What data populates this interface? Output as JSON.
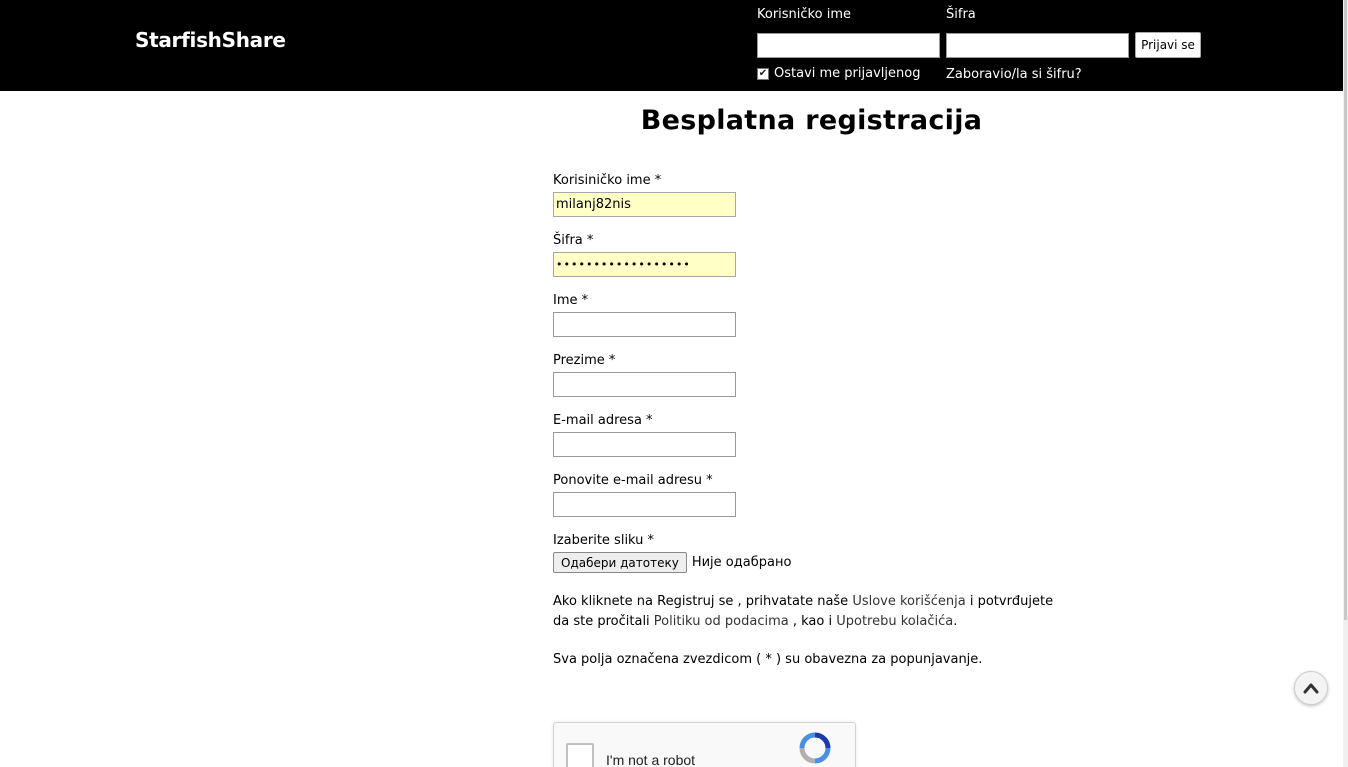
{
  "header": {
    "brand": "StarfishShare",
    "username_label": "Korisničko ime",
    "password_label": "Šifra",
    "login_button": "Prijavi se",
    "remember_label": "Ostavi me prijavljenog",
    "forgot_link": "Zaboravio/la si šifru?",
    "remember_checked": true
  },
  "page": {
    "title": "Besplatna registracija"
  },
  "form": {
    "fields": [
      {
        "label": "Korisiničko ime *",
        "value": "milanj82nis",
        "type": "text"
      },
      {
        "label": "Šifra *",
        "value": "••••••••••••••••••",
        "type": "password"
      },
      {
        "label": "Ime *",
        "value": "",
        "type": "text"
      },
      {
        "label": "Prezime *",
        "value": "",
        "type": "text"
      },
      {
        "label": "E-mail adresa *",
        "value": "",
        "type": "text"
      },
      {
        "label": "Ponovite e-mail adresu *",
        "value": "",
        "type": "text"
      }
    ],
    "image_label": "Izaberite sliku *",
    "file_button": "Одабери датотеку",
    "file_status": "Није одабрано"
  },
  "terms": {
    "part1": "Ako kliknete na Registruj se , prihvatate naše ",
    "link1": "Uslove korišćenja",
    "part2": " i potvrđujete da ste pročitali ",
    "link2": "Politiku od podacima",
    "part3": " , kao i ",
    "link3": "Upotrebu kolačića",
    "part4": ".",
    "required_note": "Sva polja označena zvezdicom ( * ) su obavezna za popunjavanje."
  },
  "captcha": {
    "label": "I'm not a robot"
  },
  "icons": {
    "scroll_top": "chevron-up-icon",
    "captcha_logo": "recaptcha-logo-icon"
  },
  "colors": {
    "header_bg": "#000000",
    "autofill_bg": "#ffffc6"
  }
}
